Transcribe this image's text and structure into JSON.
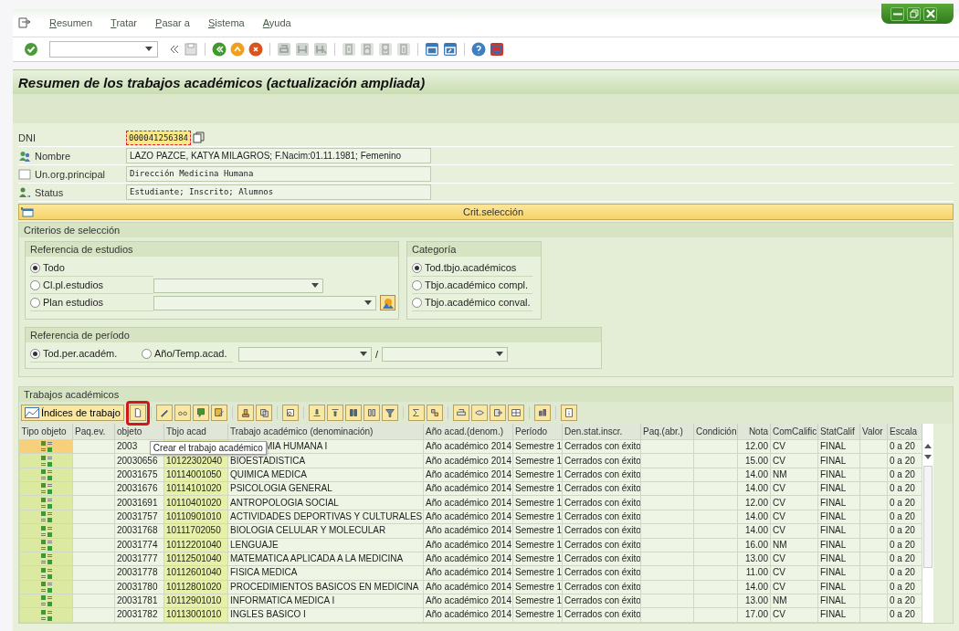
{
  "menu": [
    "Resumen",
    "Tratar",
    "Pasar a",
    "Sistema",
    "Ayuda"
  ],
  "title": "Resumen de los trabajos académicos (actualización ampliada)",
  "header_fields": [
    {
      "label": "DNI",
      "value": "000041256384",
      "kind": "key"
    },
    {
      "label": "Nombre",
      "value": "LAZO PAZCE, KATYA MILAGROS; F.Nacim:01.11.1981; Femenino",
      "kind": "person"
    },
    {
      "label": "Un.org.principal",
      "value": "Dirección Medicina Humana",
      "kind": "org"
    },
    {
      "label": "Status",
      "value": "Estudiante; Inscrito; Alumnos",
      "kind": "status"
    }
  ],
  "criteria_bar": "Crit.selección",
  "criteria": {
    "title": "Criterios de selección",
    "study_ref": {
      "title": "Referencia de estudios",
      "options": [
        {
          "label": "Todo",
          "selected": true,
          "kind": "plain"
        },
        {
          "label": "Cl.pl.estudios",
          "selected": false,
          "kind": "dropdown"
        },
        {
          "label": "Plan estudios",
          "selected": false,
          "kind": "dropdown-button"
        }
      ]
    },
    "category": {
      "title": "Categoría",
      "options": [
        {
          "label": "Tod.tbjo.académicos",
          "selected": true
        },
        {
          "label": "Tbjo.académico compl.",
          "selected": false
        },
        {
          "label": "Tbjo.académico conval.",
          "selected": false
        }
      ]
    },
    "period_ref": {
      "title": "Referencia de período",
      "options": [
        {
          "label": "Tod.per.académ.",
          "selected": true
        },
        {
          "label": "Año/Temp.acad.",
          "selected": false
        }
      ],
      "separator": "/"
    }
  },
  "works": {
    "title": "Trabajos académicos",
    "index_button": "Índices de trabajo",
    "tooltip": "Crear el trabajo académico",
    "columns": [
      "Tipo objeto",
      "Paq.ev.",
      "objeto",
      "Tbjo acad",
      "Trabajo académico (denominación)",
      "Año acad.(denom.)",
      "Período",
      "Den.stat.inscr.",
      "Paq.(abr.)",
      "Condición",
      "Nota",
      "ComCalific",
      "StatCalif",
      "Valor",
      "Escala"
    ],
    "rows": [
      {
        "selected": true,
        "id": "2003",
        "name": "MIA HUMANA I",
        "year": "Año académico 2014",
        "period": "Semestre 1",
        "status": "Cerrados con éxito",
        "grade": "12.00",
        "comcalif": "CV",
        "statcalif": "FINAL",
        "scale": "0 a 20"
      },
      {
        "selected": false,
        "id": "20030656",
        "code": "10122302040",
        "name": "BIOESTADISTICA",
        "year": "Año académico 2014",
        "period": "Semestre 1",
        "status": "Cerrados con éxito",
        "grade": "15.00",
        "comcalif": "CV",
        "statcalif": "FINAL",
        "scale": "0 a 20"
      },
      {
        "selected": false,
        "id": "20031675",
        "code": "10114001050",
        "name": "QUIMICA MEDICA",
        "year": "Año académico 2014",
        "period": "Semestre 1",
        "status": "Cerrados con éxito",
        "grade": "14.00",
        "comcalif": "NM",
        "statcalif": "FINAL",
        "scale": "0 a 20"
      },
      {
        "selected": false,
        "id": "20031676",
        "code": "10114101020",
        "name": "PSICOLOGIA GENERAL",
        "year": "Año académico 2014",
        "period": "Semestre 1",
        "status": "Cerrados con éxito",
        "grade": "14.00",
        "comcalif": "CV",
        "statcalif": "FINAL",
        "scale": "0 a 20"
      },
      {
        "selected": false,
        "id": "20031691",
        "code": "10110401020",
        "name": "ANTROPOLOGIA SOCIAL",
        "year": "Año académico 2014",
        "period": "Semestre 1",
        "status": "Cerrados con éxito",
        "grade": "12.00",
        "comcalif": "CV",
        "statcalif": "FINAL",
        "scale": "0 a 20"
      },
      {
        "selected": false,
        "id": "20031757",
        "code": "10110901010",
        "name": "ACTIVIDADES DEPORTIVAS Y CULTURALES",
        "year": "Año académico 2014",
        "period": "Semestre 1",
        "status": "Cerrados con éxito",
        "grade": "14.00",
        "comcalif": "CV",
        "statcalif": "FINAL",
        "scale": "0 a 20"
      },
      {
        "selected": false,
        "id": "20031768",
        "code": "10111702050",
        "name": "BIOLOGIA CELULAR Y MOLECULAR",
        "year": "Año académico 2014",
        "period": "Semestre 1",
        "status": "Cerrados con éxito",
        "grade": "14.00",
        "comcalif": "CV",
        "statcalif": "FINAL",
        "scale": "0 a 20"
      },
      {
        "selected": false,
        "id": "20031774",
        "code": "10112201040",
        "name": "LENGUAJE",
        "year": "Año académico 2014",
        "period": "Semestre 1",
        "status": "Cerrados con éxito",
        "grade": "16.00",
        "comcalif": "NM",
        "statcalif": "FINAL",
        "scale": "0 a 20"
      },
      {
        "selected": false,
        "id": "20031777",
        "code": "10112501040",
        "name": "MATEMATICA APLICADA A LA MEDICINA",
        "year": "Año académico 2014",
        "period": "Semestre 1",
        "status": "Cerrados con éxito",
        "grade": "13.00",
        "comcalif": "CV",
        "statcalif": "FINAL",
        "scale": "0 a 20"
      },
      {
        "selected": false,
        "id": "20031778",
        "code": "10112601040",
        "name": "FISICA MEDICA",
        "year": "Año académico 2014",
        "period": "Semestre 1",
        "status": "Cerrados con éxito",
        "grade": "11.00",
        "comcalif": "CV",
        "statcalif": "FINAL",
        "scale": "0 a 20"
      },
      {
        "selected": false,
        "id": "20031780",
        "code": "10112801020",
        "name": "PROCEDIMIENTOS BASICOS EN MEDICINA",
        "year": "Año académico 2014",
        "period": "Semestre 1",
        "status": "Cerrados con éxito",
        "grade": "14.00",
        "comcalif": "CV",
        "statcalif": "FINAL",
        "scale": "0 a 20"
      },
      {
        "selected": false,
        "id": "20031781",
        "code": "10112901010",
        "name": "INFORMATICA MEDICA I",
        "year": "Año académico 2014",
        "period": "Semestre 1",
        "status": "Cerrados con éxito",
        "grade": "13.00",
        "comcalif": "NM",
        "statcalif": "FINAL",
        "scale": "0 a 20"
      },
      {
        "selected": false,
        "id": "20031782",
        "code": "10113001010",
        "name": "INGLES BASICO I",
        "year": "Año académico 2014",
        "period": "Semestre 1",
        "status": "Cerrados con éxito",
        "grade": "17.00",
        "comcalif": "CV",
        "statcalif": "FINAL",
        "scale": "0 a 20"
      }
    ]
  }
}
